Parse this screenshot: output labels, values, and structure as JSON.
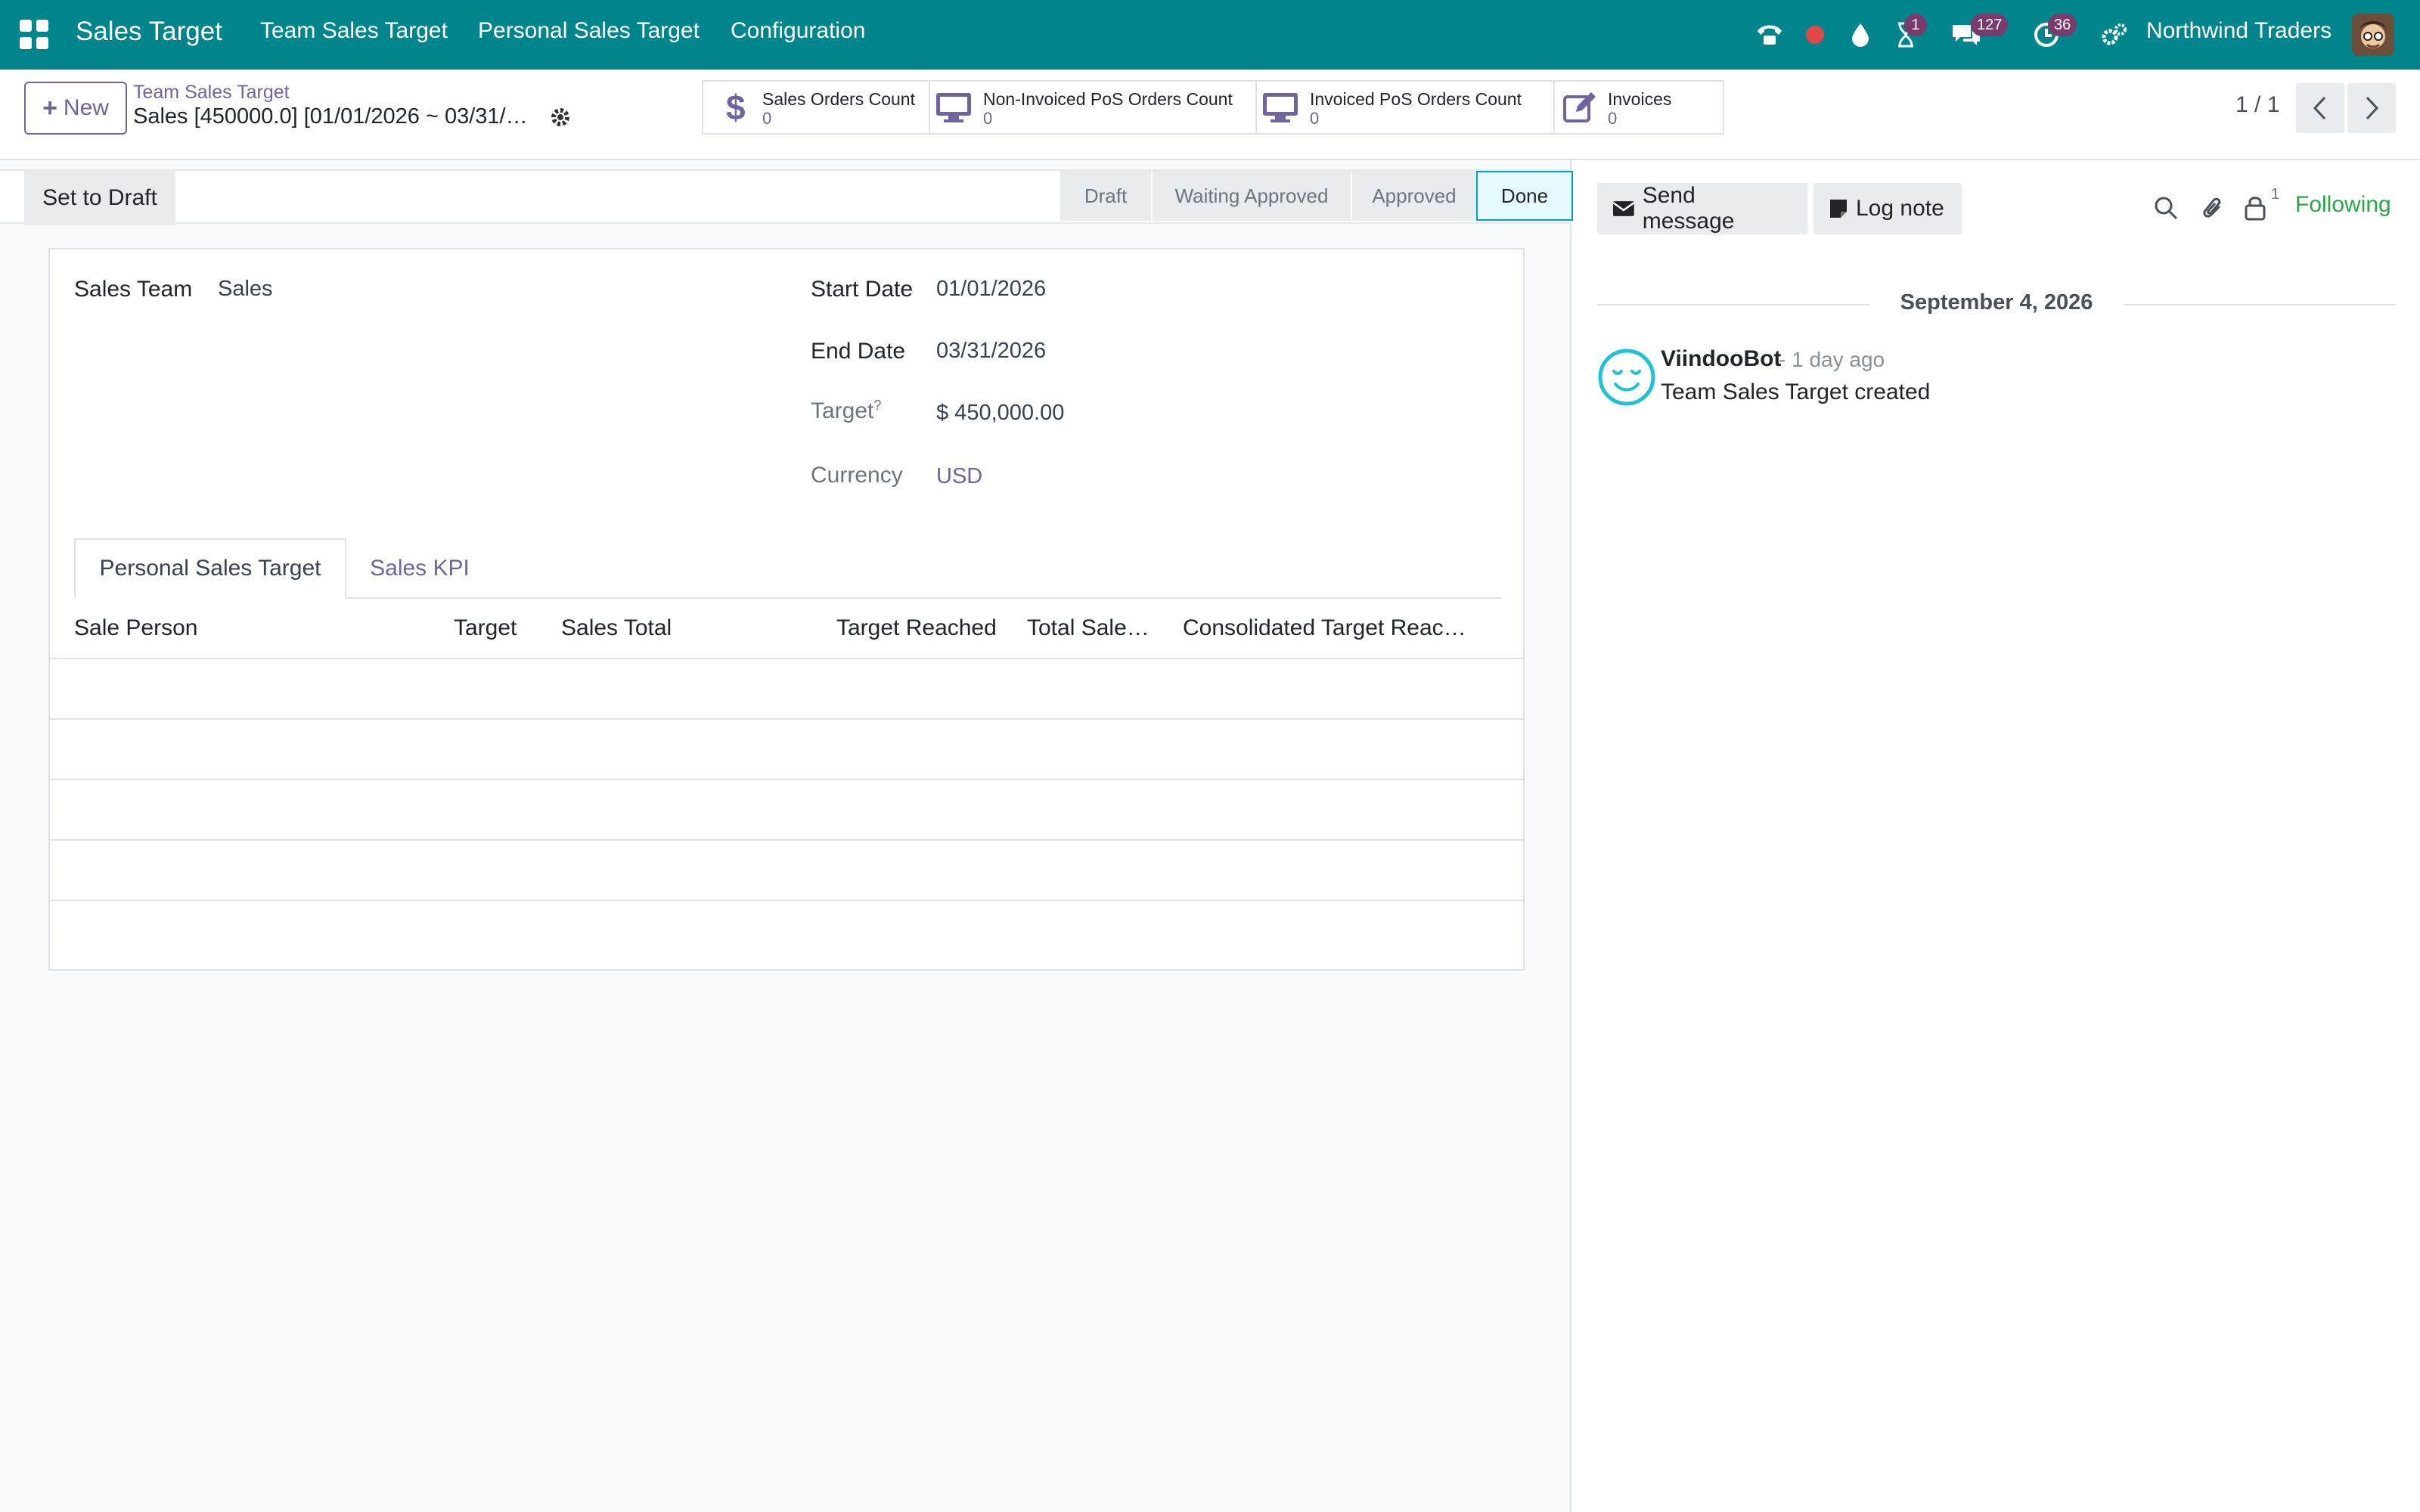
{
  "navbar": {
    "app_name": "Sales Target",
    "menu": [
      "Team Sales Target",
      "Personal Sales Target",
      "Configuration"
    ],
    "activity_badge": "1",
    "messages_badge": "127",
    "clock_badge": "36",
    "company": "Northwind Traders"
  },
  "control": {
    "new_label": "New",
    "breadcrumb_parent": "Team Sales Target",
    "breadcrumb_current": "Sales [450000.0] [01/01/2026 ~ 03/31/…",
    "smart_buttons": [
      {
        "label": "Sales Orders Count",
        "value": "0",
        "icon": "dollar-icon"
      },
      {
        "label": "Non-Invoiced PoS Orders Count",
        "value": "0",
        "icon": "monitor-icon"
      },
      {
        "label": "Invoiced PoS Orders Count",
        "value": "0",
        "icon": "monitor-icon"
      },
      {
        "label": "Invoices",
        "value": "0",
        "icon": "pencil-square-icon"
      }
    ],
    "pager": "1 / 1"
  },
  "statusbar": {
    "set_to_draft": "Set to Draft",
    "stages": [
      "Draft",
      "Waiting Approved",
      "Approved",
      "Done"
    ],
    "current_stage": "Done"
  },
  "form": {
    "sales_team_label": "Sales Team",
    "sales_team_value": "Sales",
    "start_date_label": "Start Date",
    "start_date_value": "01/01/2026",
    "end_date_label": "End Date",
    "end_date_value": "03/31/2026",
    "target_label": "Target",
    "target_help": "?",
    "target_value": "$ 450,000.00",
    "currency_label": "Currency",
    "currency_value": "USD",
    "tabs": [
      "Personal Sales Target",
      "Sales KPI"
    ],
    "columns": [
      "Sale Person",
      "Target",
      "Sales Total",
      "Target Reached",
      "Total Sale…",
      "Consolidated Target Reac…"
    ]
  },
  "chatter": {
    "send_message": "Send message",
    "log_note": "Log note",
    "follower_count": "1",
    "following": "Following",
    "date": "September 4, 2026",
    "author": "ViindooBot",
    "time": "- 1 day ago",
    "body": "Team Sales Target created"
  },
  "colors": {
    "navbar": "#00858d",
    "primary": "#71639e",
    "following": "#28a745",
    "done_stage_border": "#00a5b8"
  }
}
